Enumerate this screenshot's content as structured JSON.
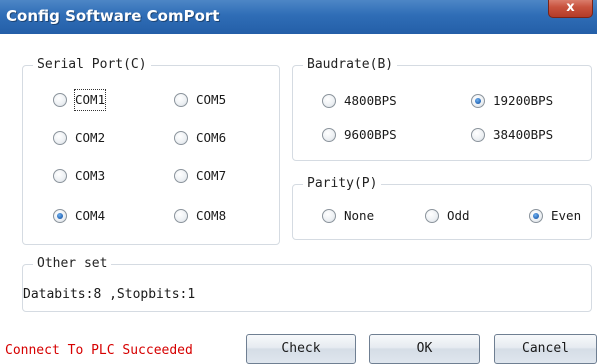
{
  "window": {
    "title": "Config Software ComPort",
    "close_label": "x"
  },
  "serial_port": {
    "legend": "Serial Port(C)",
    "options": [
      {
        "label": "COM1",
        "checked": false,
        "focused": true
      },
      {
        "label": "COM5",
        "checked": false
      },
      {
        "label": "COM2",
        "checked": false
      },
      {
        "label": "COM6",
        "checked": false
      },
      {
        "label": "COM3",
        "checked": false
      },
      {
        "label": "COM7",
        "checked": false
      },
      {
        "label": "COM4",
        "checked": true
      },
      {
        "label": "COM8",
        "checked": false
      }
    ]
  },
  "baudrate": {
    "legend": "Baudrate(B)",
    "options": [
      {
        "label": "4800BPS",
        "checked": false
      },
      {
        "label": "19200BPS",
        "checked": true
      },
      {
        "label": "9600BPS",
        "checked": false
      },
      {
        "label": "38400BPS",
        "checked": false
      }
    ]
  },
  "parity": {
    "legend": "Parity(P)",
    "options": [
      {
        "label": "None",
        "checked": false
      },
      {
        "label": "Odd",
        "checked": false
      },
      {
        "label": "Even",
        "checked": true
      }
    ]
  },
  "other_set": {
    "legend": "Other set",
    "info": "Databits:8 ,Stopbits:1"
  },
  "status": {
    "text": "Connect To PLC Succeeded",
    "color": "#d60000"
  },
  "buttons": {
    "check": "Check",
    "ok": "OK",
    "cancel": "Cancel"
  }
}
